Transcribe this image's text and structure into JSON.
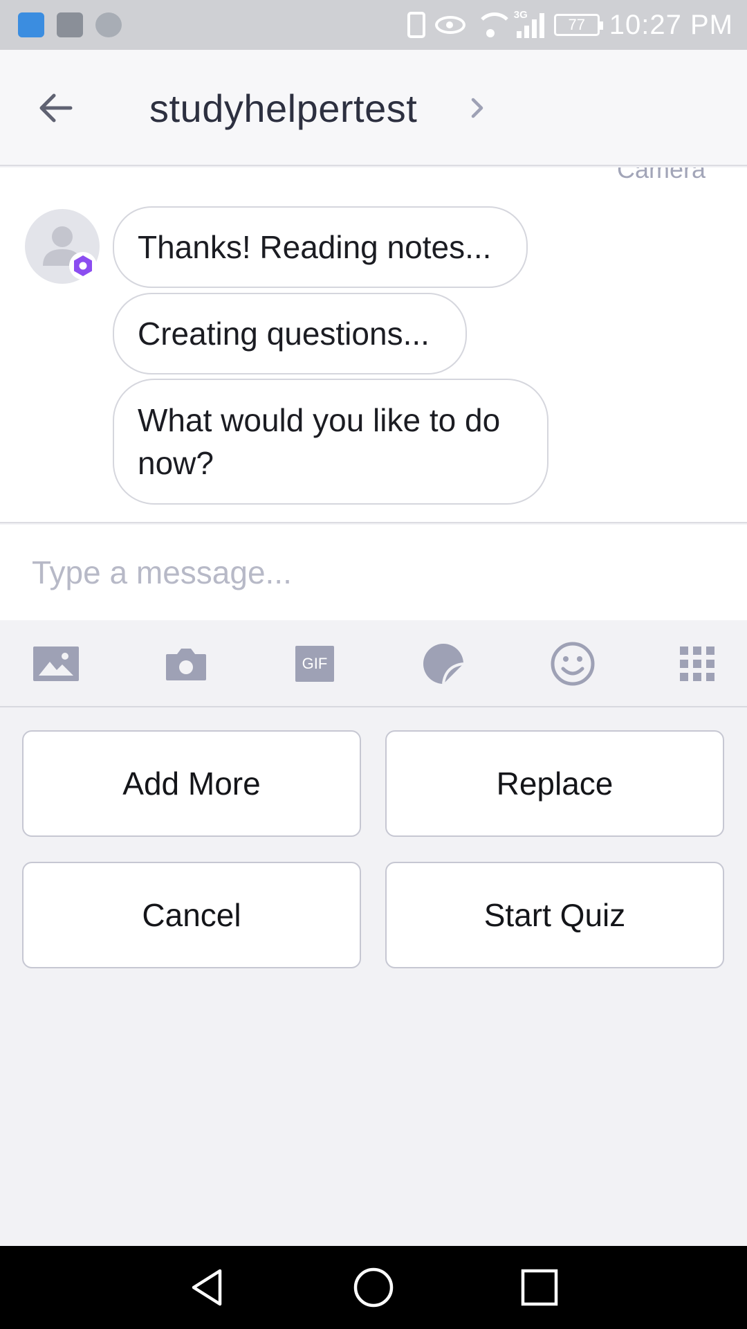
{
  "status_bar": {
    "time": "10:27 PM",
    "battery": "77",
    "network": "3G"
  },
  "header": {
    "title": "studyhelpertest"
  },
  "chat": {
    "camera_label": "Camera",
    "messages": [
      "Thanks! Reading notes...",
      "Creating questions...",
      "What would you like to do now?"
    ]
  },
  "composer": {
    "placeholder": "Type a message..."
  },
  "toolbar": {
    "gif_label": "GIF"
  },
  "quick_replies": [
    "Add More",
    "Replace",
    "Cancel",
    "Start Quiz"
  ],
  "colors": {
    "accent": "#8b4df0",
    "icon_gray": "#9ea1b5",
    "title_text": "#2d3040"
  },
  "icons": [
    "back-arrow-icon",
    "chevron-right-icon",
    "image-icon",
    "camera-icon",
    "gif-icon",
    "sticker-icon",
    "emoji-icon",
    "grid-icon"
  ]
}
